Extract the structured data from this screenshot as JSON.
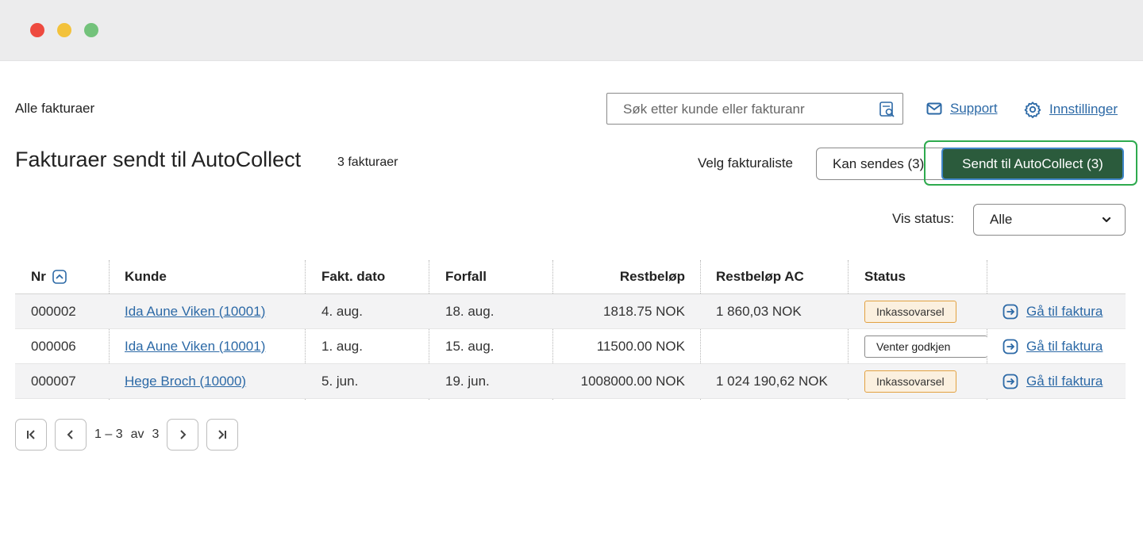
{
  "window": {
    "controls": [
      "close",
      "minimize",
      "maximize"
    ]
  },
  "breadcrumb": "Alle fakturaer",
  "search": {
    "placeholder": "Søk etter kunde eller fakturanr",
    "value": ""
  },
  "links": {
    "support": "Support",
    "settings": "Innstillinger"
  },
  "page": {
    "title": "Fakturaer sendt til AutoCollect",
    "count": "3 fakturaer"
  },
  "list_selector": {
    "label": "Velg fakturaliste",
    "options": [
      "Kan sendes (3)",
      "Sendt til AutoCollect (3)"
    ],
    "selected": "Sendt til AutoCollect (3)"
  },
  "status_filter": {
    "label": "Vis status:",
    "value": "Alle"
  },
  "table": {
    "columns": [
      "Nr",
      "Kunde",
      "Fakt. dato",
      "Forfall",
      "Restbeløp",
      "Restbeløp AC",
      "Status",
      ""
    ],
    "rows": [
      {
        "nr": "000002",
        "kunde": "Ida Aune Viken (10001)",
        "dato": "4. aug.",
        "forfall": "18. aug.",
        "rest": "1818.75 NOK",
        "rest_ac": "1 860,03 NOK",
        "status": "Inkassovarsel",
        "action": "Gå til faktura"
      },
      {
        "nr": "000006",
        "kunde": "Ida Aune Viken (10001)",
        "dato": "1. aug.",
        "forfall": "15. aug.",
        "rest": "11500.00 NOK",
        "rest_ac": "",
        "status": "Venter godkjen",
        "action": "Gå til faktura"
      },
      {
        "nr": "000007",
        "kunde": "Hege Broch (10000)",
        "dato": "5. jun.",
        "forfall": "19. jun.",
        "rest": "1008000.00 NOK",
        "rest_ac": "1 024 190,62 NOK",
        "status": "Inkassovarsel",
        "action": "Gå til faktura"
      }
    ]
  },
  "pagination": {
    "range": "1 – 3",
    "of": "av",
    "total": "3"
  },
  "colors": {
    "accent": "#2b5b3c",
    "link": "#2c69a6",
    "focus": "#2eaa4e",
    "badge_border": "#e2a140"
  }
}
